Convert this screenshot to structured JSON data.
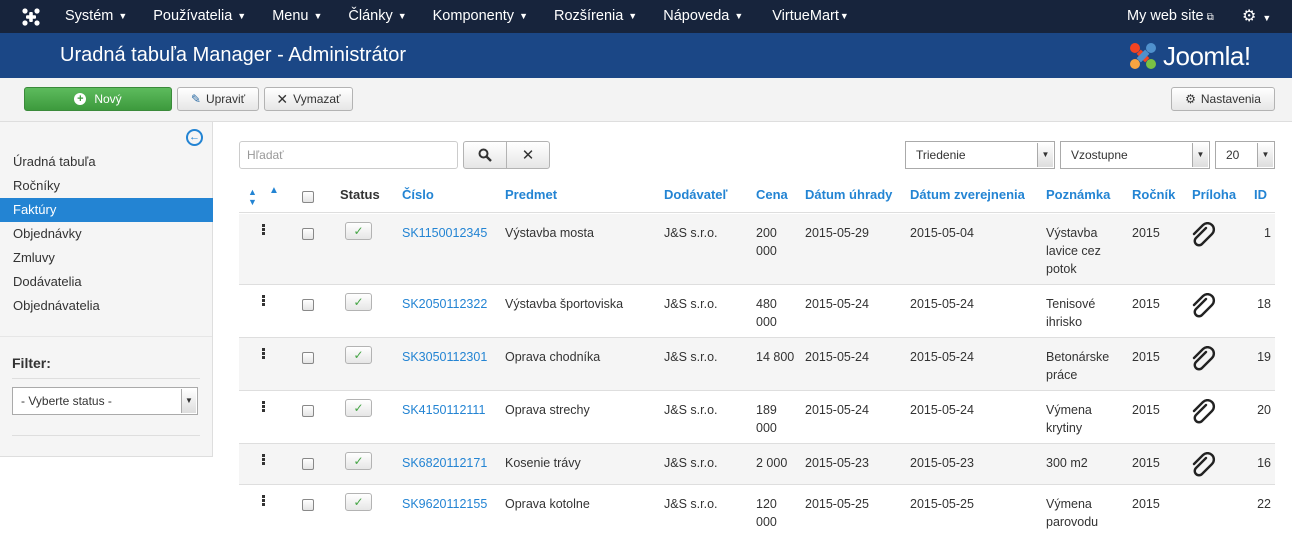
{
  "nav": {
    "items": [
      {
        "label": "Systém"
      },
      {
        "label": "Používatelia"
      },
      {
        "label": "Menu"
      },
      {
        "label": "Články"
      },
      {
        "label": "Komponenty"
      },
      {
        "label": "Rozšírenia"
      },
      {
        "label": "Nápoveda"
      },
      {
        "label": "VirtueMart"
      }
    ],
    "my_site": "My web site"
  },
  "header": {
    "title": "Uradná tabuľa Manager - Administrátor",
    "brand": "Joomla!"
  },
  "toolbar": {
    "new_label": "Nový",
    "edit_label": "Upraviť",
    "delete_label": "Vymazať",
    "options_label": "Nastavenia"
  },
  "sidebar": {
    "items": [
      {
        "label": "Úradná tabuľa"
      },
      {
        "label": "Ročníky"
      },
      {
        "label": "Faktúry",
        "active": true
      },
      {
        "label": "Objednávky"
      },
      {
        "label": "Zmluvy"
      },
      {
        "label": "Dodávatelia"
      },
      {
        "label": "Objednávatelia"
      }
    ],
    "filter_title": "Filter:",
    "status_select": "- Vyberte status -"
  },
  "search": {
    "placeholder": "Hľadať",
    "sort_select": "Triedenie",
    "direction_select": "Vzostupne",
    "limit_select": "20"
  },
  "table": {
    "headers": {
      "status": "Status",
      "number": "Číslo",
      "subject": "Predmet",
      "supplier": "Dodávateľ",
      "price": "Cena",
      "due_date": "Dátum úhrady",
      "published_date": "Dátum zverejnenia",
      "note": "Poznámka",
      "year": "Ročník",
      "attachment": "Príloha",
      "id": "ID"
    },
    "rows": [
      {
        "number": "SK1150012345",
        "subject": "Výstavba mosta",
        "supplier": "J&S s.r.o.",
        "price": "200 000",
        "due": "2015-05-29",
        "published": "2015-05-04",
        "note": "Výstavba lavice cez potok",
        "year": "2015",
        "attachment": true,
        "id": "1"
      },
      {
        "number": "SK2050112322",
        "subject": "Výstavba športoviska",
        "supplier": "J&S s.r.o.",
        "price": "480 000",
        "due": "2015-05-24",
        "published": "2015-05-24",
        "note": "Tenisové ihrisko",
        "year": "2015",
        "attachment": true,
        "id": "18"
      },
      {
        "number": "SK3050112301",
        "subject": "Oprava chodníka",
        "supplier": "J&S s.r.o.",
        "price": "14 800",
        "due": "2015-05-24",
        "published": "2015-05-24",
        "note": "Betonárske práce",
        "year": "2015",
        "attachment": true,
        "id": "19"
      },
      {
        "number": "SK4150112111",
        "subject": "Oprava strechy",
        "supplier": "J&S s.r.o.",
        "price": "189 000",
        "due": "2015-05-24",
        "published": "2015-05-24",
        "note": "Výmena krytiny",
        "year": "2015",
        "attachment": true,
        "id": "20"
      },
      {
        "number": "SK6820112171",
        "subject": "Kosenie trávy",
        "supplier": "J&S s.r.o.",
        "price": "2 000",
        "due": "2015-05-23",
        "published": "2015-05-23",
        "note": "300 m2",
        "year": "2015",
        "attachment": true,
        "id": "16"
      },
      {
        "number": "SK9620112155",
        "subject": "Oprava kotolne",
        "supplier": "J&S s.r.o.",
        "price": "120 000",
        "due": "2015-05-25",
        "published": "2015-05-25",
        "note": "Výmena parovodu",
        "year": "2015",
        "attachment": false,
        "id": "22"
      }
    ]
  },
  "colors": {
    "topbar": "#17243c",
    "header": "#1b4786",
    "accent": "#2384d3",
    "success": "#46a546"
  }
}
